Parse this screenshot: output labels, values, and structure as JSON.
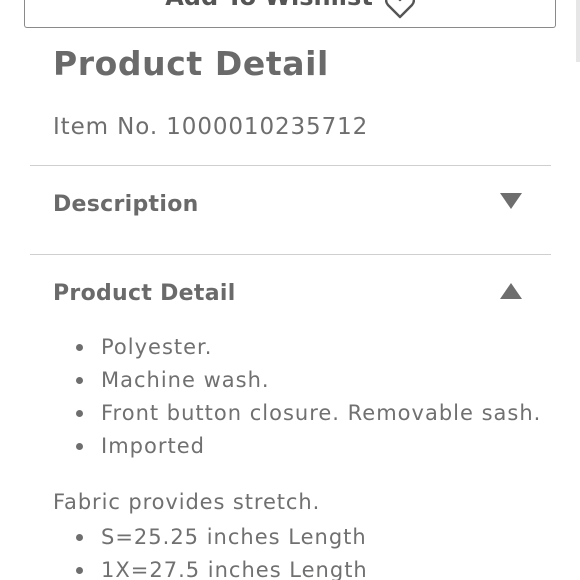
{
  "wishlist": {
    "label": "Add To Wishlist"
  },
  "product": {
    "title": "Product Detail",
    "item_no": "Item No. 1000010235712"
  },
  "accordion": {
    "description": {
      "label": "Description",
      "state": "collapsed",
      "icon": "triangle-down-icon"
    },
    "detail": {
      "label": "Product Detail",
      "state": "expanded",
      "icon": "triangle-up-icon"
    }
  },
  "detail_bullets": [
    "Polyester.",
    "Machine wash.",
    "Front button closure. Removable sash.",
    "Imported"
  ],
  "fabric_note": "Fabric provides stretch.",
  "size_bullets": [
    "S=25.25 inches Length",
    "1X=27.5 inches Length"
  ],
  "colors": {
    "text": "#6b6b6b",
    "divider": "#cfcfcf",
    "border": "#8a8a8a",
    "background": "#ffffff"
  }
}
